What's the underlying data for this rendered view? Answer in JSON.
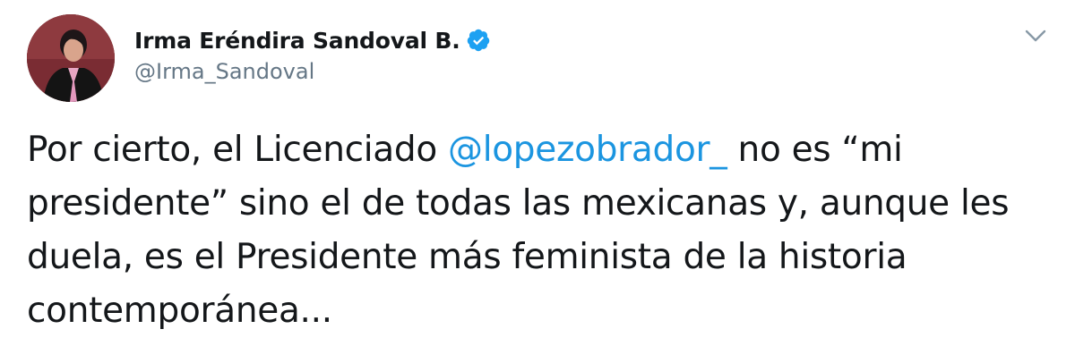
{
  "author": {
    "display_name": "Irma Eréndira Sandoval B.",
    "handle": "@Irma_Sandoval",
    "verified": true,
    "avatar_icon": "profile-photo"
  },
  "menu": {
    "icon": "chevron-down-icon"
  },
  "tweet": {
    "line1_pre": "Por cierto, el Licenciado ",
    "mention": "@lopezobrador_",
    "line1_post": " no es “mi",
    "line2": "presidente” sino el de todas las mexicanas y, aunque les",
    "line3": "duela, es el Presidente más feminista de la historia",
    "line4": "contemporánea..."
  },
  "colors": {
    "text": "#14171a",
    "secondary": "#657786",
    "link": "#1b95e0",
    "verified": "#1da1f2"
  }
}
